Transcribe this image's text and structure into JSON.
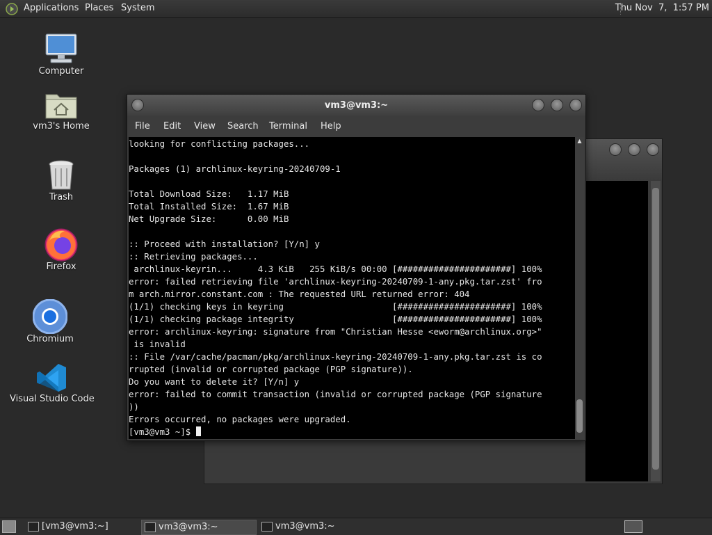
{
  "top_panel": {
    "menus": [
      "Applications",
      "Places",
      "System"
    ],
    "clock": "Thu Nov  7,  1:57 PM"
  },
  "desktop_icons": [
    {
      "label": "Computer",
      "icon": "computer-icon"
    },
    {
      "label": "vm3's Home",
      "icon": "home-folder-icon"
    },
    {
      "label": "Trash",
      "icon": "trash-icon"
    },
    {
      "label": "Firefox",
      "icon": "firefox-icon"
    },
    {
      "label": "Chromium",
      "icon": "chromium-icon"
    },
    {
      "label": "Visual Studio Code",
      "icon": "vscode-icon"
    }
  ],
  "terminal": {
    "title": "vm3@vm3:~",
    "menu": [
      "File",
      "Edit",
      "View",
      "Search",
      "Terminal",
      "Help"
    ],
    "lines": [
      "looking for conflicting packages...",
      "",
      "Packages (1) archlinux-keyring-20240709-1",
      "",
      "Total Download Size:   1.17 MiB",
      "Total Installed Size:  1.67 MiB",
      "Net Upgrade Size:      0.00 MiB",
      "",
      ":: Proceed with installation? [Y/n] y",
      ":: Retrieving packages...",
      " archlinux-keyrin...     4.3 KiB   255 KiB/s 00:00 [######################] 100%",
      "error: failed retrieving file 'archlinux-keyring-20240709-1-any.pkg.tar.zst' fro",
      "m arch.mirror.constant.com : The requested URL returned error: 404",
      "(1/1) checking keys in keyring                     [######################] 100%",
      "(1/1) checking package integrity                   [######################] 100%",
      "error: archlinux-keyring: signature from \"Christian Hesse <eworm@archlinux.org>\"",
      " is invalid",
      ":: File /var/cache/pacman/pkg/archlinux-keyring-20240709-1-any.pkg.tar.zst is co",
      "rrupted (invalid or corrupted package (PGP signature)).",
      "Do you want to delete it? [Y/n] y",
      "error: failed to commit transaction (invalid or corrupted package (PGP signature",
      "))",
      "Errors occurred, no packages were upgraded."
    ],
    "prompt": "[vm3@vm3 ~]$ "
  },
  "taskbar": {
    "tasks": [
      {
        "label": "[vm3@vm3:~]",
        "active": false
      },
      {
        "label": "vm3@vm3:~",
        "active": true
      },
      {
        "label": "vm3@vm3:~",
        "active": false
      }
    ]
  }
}
